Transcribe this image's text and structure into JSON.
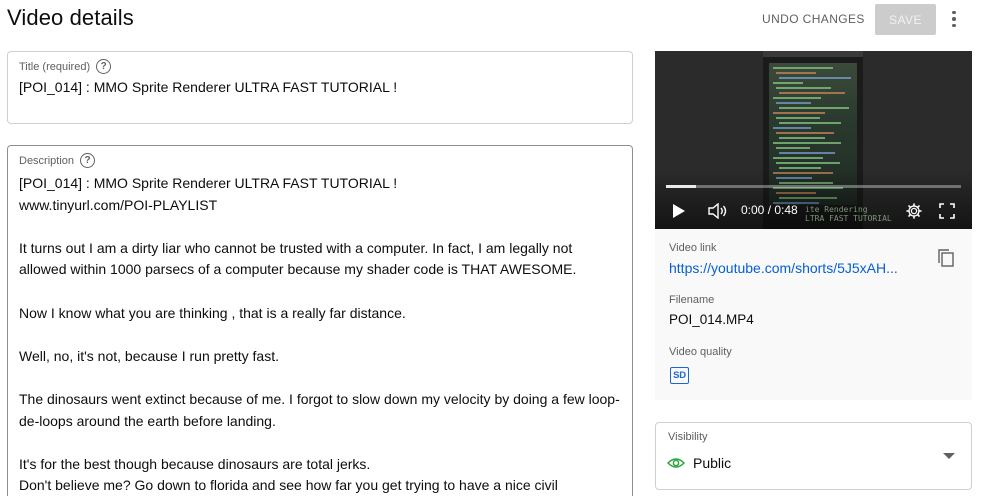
{
  "header": {
    "title": "Video details",
    "undo_label": "UNDO CHANGES",
    "save_label": "SAVE"
  },
  "title_field": {
    "label": "Title (required)",
    "value": "[POI_014] : MMO Sprite Renderer ULTRA FAST TUTORIAL !"
  },
  "description_field": {
    "label": "Description",
    "lines": [
      "[POI_014] : MMO Sprite Renderer ULTRA FAST TUTORIAL !",
      "www.tinyurl.com/POI-PLAYLIST",
      "",
      "It turns out I am a dirty liar who cannot be trusted with a computer. In fact, I am legally not",
      "allowed within 1000 parsecs of a computer because my shader code is THAT AWESOME.",
      "",
      "Now I know what you are thinking , that is a really far distance.",
      "",
      "Well, no, it's not, because I run pretty fast.",
      "",
      "The dinosaurs went extinct because of me. I forgot to slow down my velocity by doing a few loop-",
      "de-loops around the earth before landing.",
      "",
      "It's for the best though because dinosaurs are total jerks.",
      "Don't believe me? Go down to florida and see how far you get trying to have a nice civil"
    ]
  },
  "player": {
    "time_current": "0:00",
    "time_separator": " / ",
    "time_total": "0:48",
    "progress": 0.1,
    "overlay_line1": "ite Rendering",
    "overlay_line2": "LTRA FAST TUTORIAL"
  },
  "video_info": {
    "link_label": "Video link",
    "link_value": "https://youtube.com/shorts/5J5xAH...",
    "filename_label": "Filename",
    "filename_value": "POI_014.MP4",
    "quality_label": "Video quality",
    "quality_badge": "SD"
  },
  "visibility": {
    "label": "Visibility",
    "value": "Public"
  },
  "colors": {
    "accent_link": "#065fd4",
    "public_green": "#2ba640",
    "sd_blue": "#1e66d0"
  },
  "icons": [
    "help-icon",
    "kebab-menu-icon",
    "play-icon",
    "volume-icon",
    "settings-gear-icon",
    "fullscreen-icon",
    "copy-icon",
    "sd-quality-icon",
    "eye-icon",
    "chevron-down-icon"
  ]
}
